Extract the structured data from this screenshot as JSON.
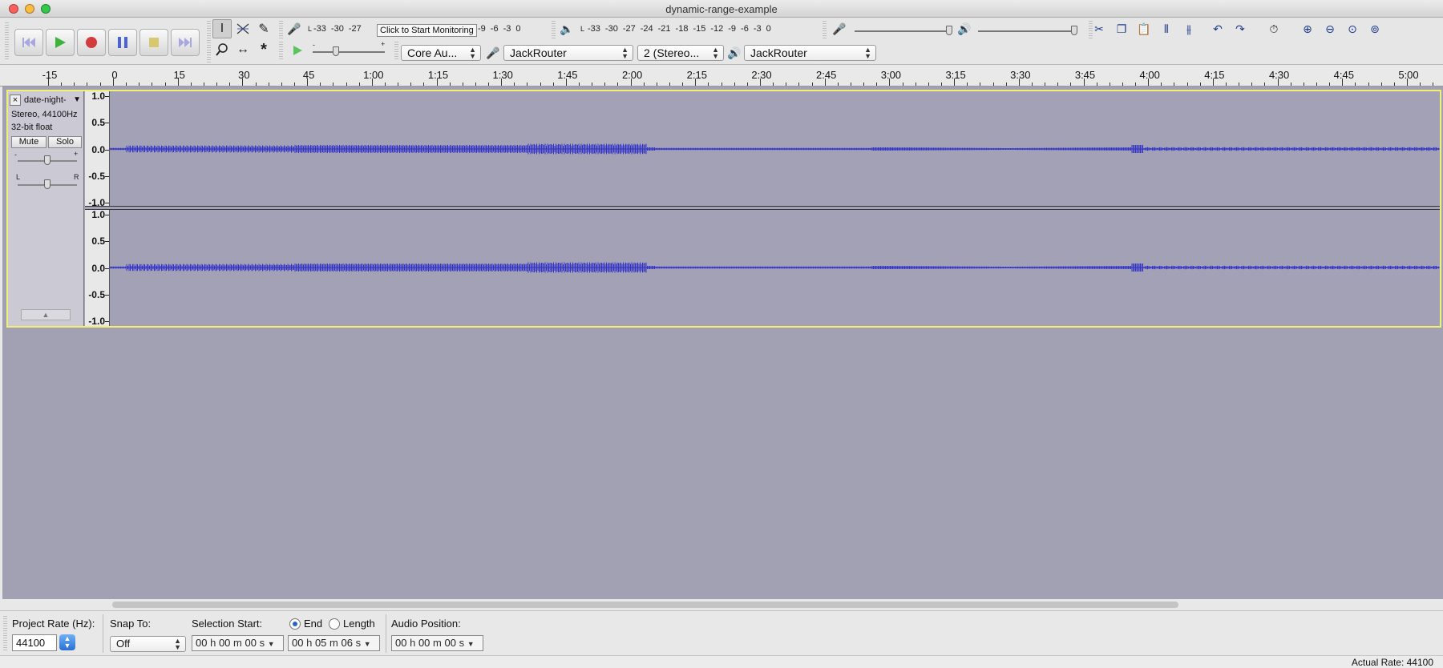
{
  "window": {
    "title": "dynamic-range-example"
  },
  "meters": {
    "record_scale": [
      "-33",
      "-30",
      "-27"
    ],
    "record_scale_tail": [
      "-9",
      "-6",
      "-3",
      "0"
    ],
    "monitor_tip": "Click to Start Monitoring",
    "play_scale": [
      "-33",
      "-30",
      "-27",
      "-24",
      "-21",
      "-18",
      "-15",
      "-12",
      "-9",
      "-6",
      "-3",
      "0"
    ],
    "lr": {
      "l": "L",
      "r": "R"
    }
  },
  "devices": {
    "host": "Core Au...",
    "input_device": "JackRouter",
    "input_channels": "2 (Stereo...",
    "output_device": "JackRouter"
  },
  "ruler": {
    "labels": [
      "-15",
      "0",
      "15",
      "30",
      "45",
      "1:00",
      "1:15",
      "1:30",
      "1:45",
      "2:00",
      "2:15",
      "2:30",
      "2:45",
      "3:00",
      "3:15",
      "3:30",
      "3:45",
      "4:00",
      "4:15",
      "4:30",
      "4:45",
      "5:00"
    ]
  },
  "track": {
    "name": "date-night-",
    "format": "Stereo, 44100Hz",
    "bitdepth": "32-bit float",
    "mute_label": "Mute",
    "solo_label": "Solo",
    "gain_minus": "-",
    "gain_plus": "+",
    "pan_l": "L",
    "pan_r": "R",
    "scale": [
      "1.0",
      "0.5",
      "0.0",
      "-0.5",
      "-1.0"
    ],
    "wave_color": "#3232c8"
  },
  "selection_bar": {
    "project_rate_label": "Project Rate (Hz):",
    "project_rate": "44100",
    "snap_to_label": "Snap To:",
    "snap_to": "Off",
    "selection_start_label": "Selection Start:",
    "selection_start": {
      "h": "00",
      "m": "00",
      "s": "00"
    },
    "end_label": "End",
    "length_label": "Length",
    "end": {
      "h": "00",
      "m": "05",
      "s": "06"
    },
    "audio_position_label": "Audio Position:",
    "audio_position": {
      "h": "00",
      "m": "00",
      "s": "00"
    },
    "unit_h": "h",
    "unit_m": "m",
    "unit_s": "s"
  },
  "status": {
    "actual_rate": "Actual Rate: 44100"
  }
}
